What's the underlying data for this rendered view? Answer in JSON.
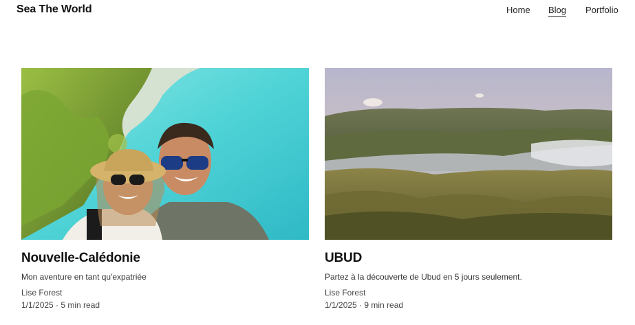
{
  "site": {
    "title": "Sea The World"
  },
  "nav": {
    "home": "Home",
    "blog": "Blog",
    "portfolio": "Portfolio",
    "active": "Blog"
  },
  "posts": [
    {
      "title": "Nouvelle-Calédonie",
      "excerpt": "Mon aventure en tant qu'expatriée",
      "author": "Lise Forest",
      "meta": "1/1/2025 · 5 min read",
      "image": "selfie-couple-lagoon-photo"
    },
    {
      "title": "UBUD",
      "excerpt": "Partez à la découverte de Ubud en 5 jours seulement.",
      "author": "Lise Forest",
      "meta": "1/1/2025 · 9 min read",
      "image": "volcanic-valley-landscape-photo"
    }
  ],
  "colors": {
    "lagoon": "#4fd3d6",
    "vegetation": "#6b8e2f",
    "sky": "#c9b9c7",
    "hills": "#7a7f47"
  }
}
